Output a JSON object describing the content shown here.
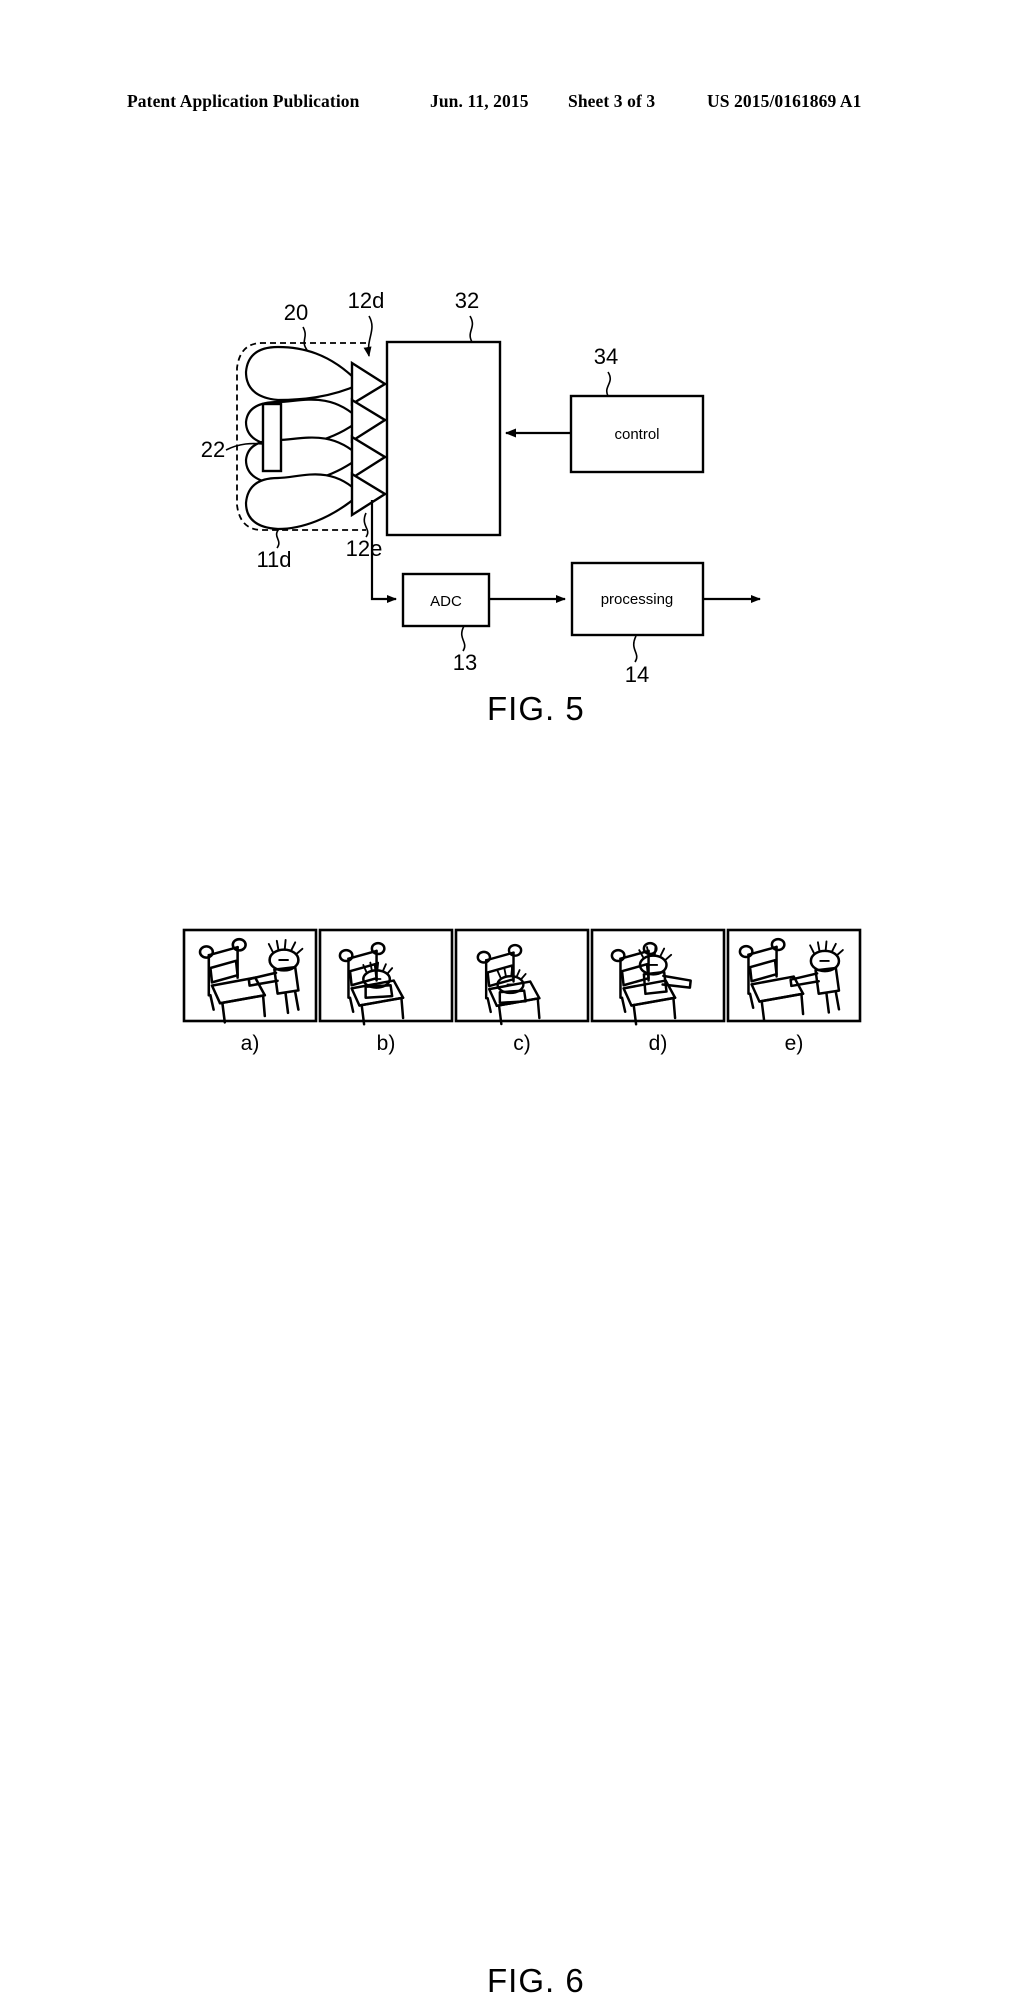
{
  "header": {
    "publication": "Patent Application Publication",
    "date": "Jun. 11, 2015",
    "sheet": "Sheet 3 of 3",
    "number": "US 2015/0161869 A1"
  },
  "figure5": {
    "caption": "FIG. 5",
    "blocks": [
      {
        "id": "block-32",
        "label": "",
        "ref": "32"
      },
      {
        "id": "block-control",
        "label": "control",
        "ref": "34"
      },
      {
        "id": "block-adc",
        "label": "ADC",
        "ref": "13"
      },
      {
        "id": "block-processing",
        "label": "processing",
        "ref": "14"
      }
    ],
    "block32_ref": "32",
    "control_label": "control",
    "control_ref": "34",
    "adc_label": "ADC",
    "adc_ref": "13",
    "processing_label": "processing",
    "processing_ref": "14",
    "ref_antenna_array": "20",
    "ref_element_22": "22",
    "ref_11d": "11d",
    "ref_12d": "12d",
    "ref_12e": "12e",
    "amplifier_count": 4,
    "lobe_count": 4
  },
  "figure6": {
    "caption": "FIG. 6",
    "panels": [
      {
        "label": "a)",
        "scene": "occupant-leaning-far-forward-out-of-seat"
      },
      {
        "label": "b)",
        "scene": "occupant-seated-upright-against-backrest"
      },
      {
        "label": "c)",
        "scene": "occupant-seated-low-reclined"
      },
      {
        "label": "d)",
        "scene": "occupant-seated-arm-extended-forward"
      },
      {
        "label": "e)",
        "scene": "occupant-leaning-forward-arm-extended"
      }
    ]
  },
  "colors": {
    "ink": "#000000",
    "paper": "#ffffff"
  }
}
